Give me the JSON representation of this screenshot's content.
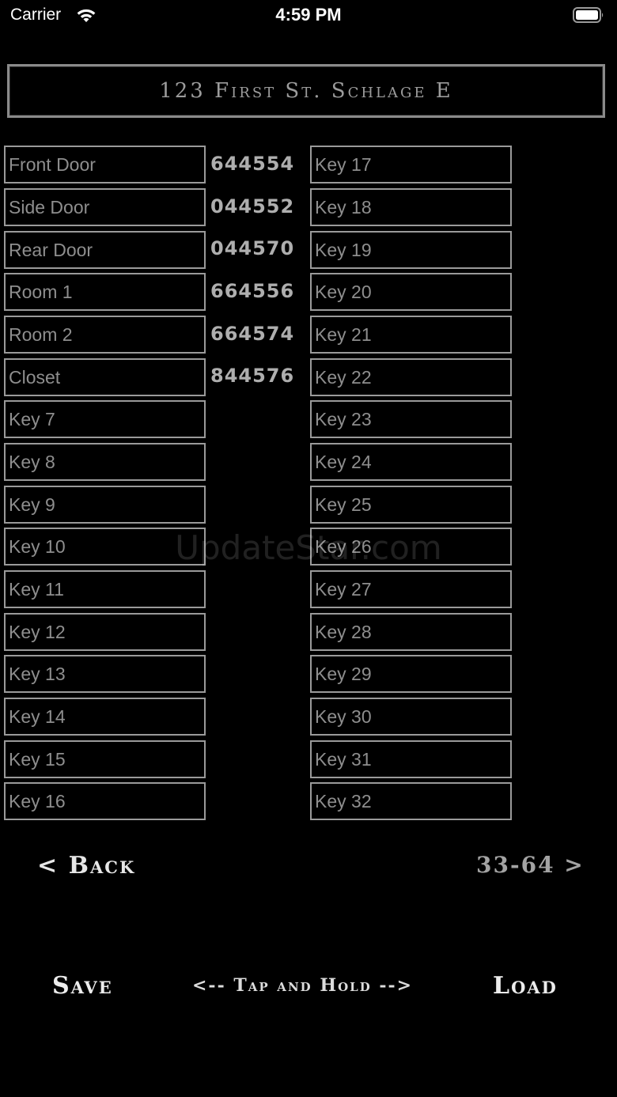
{
  "status_bar": {
    "carrier": "Carrier",
    "time": "4:59 PM",
    "wifi_icon": "wifi-icon",
    "battery_icon": "battery-icon"
  },
  "title": "123 First St. Schlage E",
  "left_keys": [
    "Front Door",
    "Side Door",
    "Rear Door",
    "Room 1",
    "Room 2",
    "Closet",
    "Key 7",
    "Key 8",
    "Key 9",
    "Key 10",
    "Key 11",
    "Key 12",
    "Key 13",
    "Key 14",
    "Key 15",
    "Key 16"
  ],
  "codes": [
    "644554",
    "044552",
    "044570",
    "664556",
    "664574",
    "844576"
  ],
  "right_keys": [
    "Key 17",
    "Key 18",
    "Key 19",
    "Key 20",
    "Key 21",
    "Key 22",
    "Key 23",
    "Key 24",
    "Key 25",
    "Key 26",
    "Key 27",
    "Key 28",
    "Key 29",
    "Key 30",
    "Key 31",
    "Key 32"
  ],
  "nav": {
    "back_label": "< Back",
    "next_label": "33-64 >"
  },
  "footer": {
    "save_label": "Save",
    "hint": "<-- Tap and Hold -->",
    "load_label": "Load"
  },
  "watermark": "UpdateStar.com"
}
